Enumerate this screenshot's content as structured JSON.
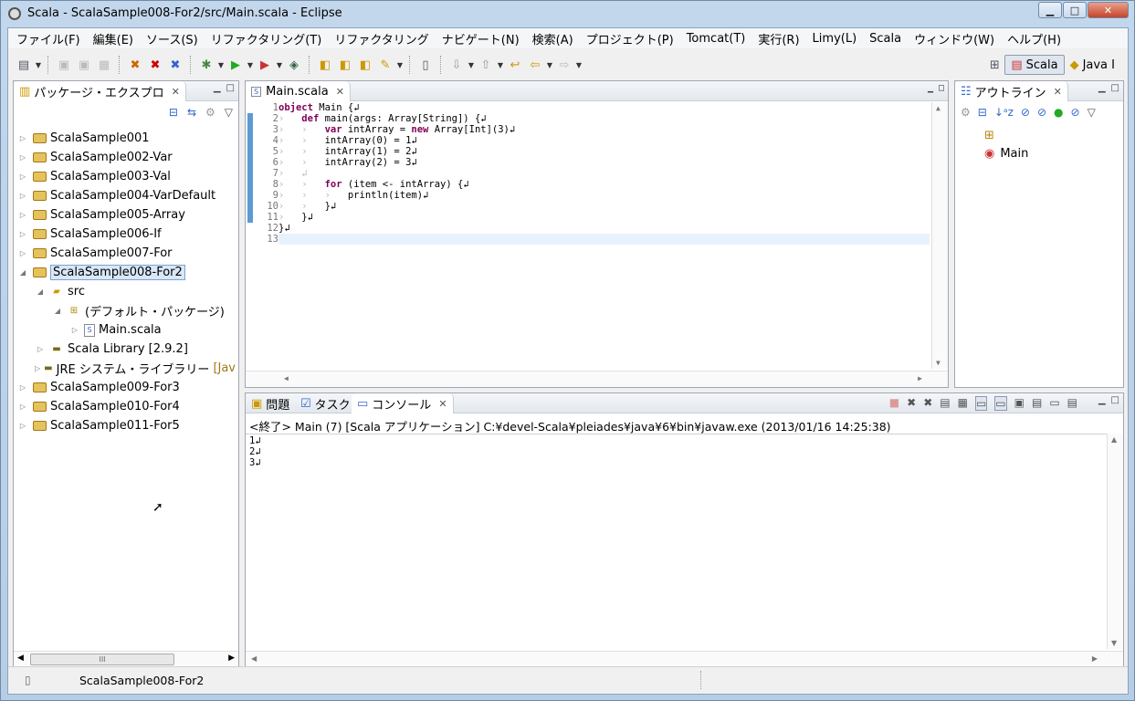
{
  "window": {
    "title": "Scala - ScalaSample008-For2/src/Main.scala - Eclipse",
    "min": "▁",
    "max": "□",
    "close": "✕"
  },
  "menu": [
    "ファイル(F)",
    "編集(E)",
    "ソース(S)",
    "リファクタリング(T)",
    "リファクタリング",
    "ナビゲート(N)",
    "検索(A)",
    "プロジェクト(P)",
    "Tomcat(T)",
    "実行(R)",
    "Limy(L)",
    "Scala",
    "ウィンドウ(W)",
    "ヘルプ(H)"
  ],
  "perspectives": {
    "scala": "Scala",
    "java": "Java I"
  },
  "package_explorer": {
    "title": "パッケージ・エクスプロ",
    "projects_top": [
      "ScalaSample001",
      "ScalaSample002-Var",
      "ScalaSample003-Val",
      "ScalaSample004-VarDefault",
      "ScalaSample005-Array",
      "ScalaSample006-If",
      "ScalaSample007-For"
    ],
    "selected": "ScalaSample008-For2",
    "src": "src",
    "default_package": "(デフォルト・パッケージ)",
    "file": "Main.scala",
    "scala_lib": "Scala Library [2.9.2]",
    "jre": "JRE システム・ライブラリー",
    "jre_suffix": "[Jav",
    "projects_bottom": [
      "ScalaSample009-For3",
      "ScalaSample010-For4",
      "ScalaSample011-For5"
    ]
  },
  "editor": {
    "tab": "Main.scala",
    "line_numbers": [
      "1",
      "2",
      "3",
      "4",
      "5",
      "6",
      "7",
      "8",
      "9",
      "10",
      "11",
      "12",
      "13"
    ],
    "lines": [
      {
        "kw": "object",
        "rest": " Main {↲"
      },
      {
        "indent": "›   ",
        "kw": "def",
        "rest": " main(args: Array[String]) {↲"
      },
      {
        "indent": "›   ›   ",
        "kw": "var",
        "rest": " intArray = ",
        "kw2": "new",
        "rest2": " Array[Int](3)↲"
      },
      {
        "indent": "›   ›   ",
        "rest": "intArray(0) = 1↲"
      },
      {
        "indent": "›   ›   ",
        "rest": "intArray(1) = 2↲"
      },
      {
        "indent": "›   ›   ",
        "rest": "intArray(2) = 3↲"
      },
      {
        "indent": "›   ",
        "rest": "↲"
      },
      {
        "indent": "›   ›   ",
        "kw": "for",
        "rest": " (item <- intArray) {↲"
      },
      {
        "indent": "›   ›   ›   ",
        "rest": "println(item)↲"
      },
      {
        "indent": "›   ›   ",
        "rest": "}↲"
      },
      {
        "indent": "›   ",
        "rest": "}↲"
      },
      {
        "rest": "}↲"
      },
      {
        "rest": ""
      }
    ]
  },
  "outline": {
    "title": "アウトライン",
    "item": "Main"
  },
  "console": {
    "tabs": {
      "problems": "問題",
      "tasks": "タスク",
      "console": "コンソール"
    },
    "launch": "<終了> Main (7) [Scala アプリケーション] C:¥devel-Scala¥pleiades¥java¥6¥bin¥javaw.exe (2013/01/16 14:25:38)",
    "output": [
      "1↲",
      "2↲",
      "3↲"
    ]
  },
  "status": {
    "text": "ScalaSample008-For2"
  },
  "scroll": {
    "thumb": "III"
  },
  "colors": {
    "keyword": "#7f0055",
    "selection": "#d9e7f7",
    "titlebar": "#c3d7ec"
  }
}
